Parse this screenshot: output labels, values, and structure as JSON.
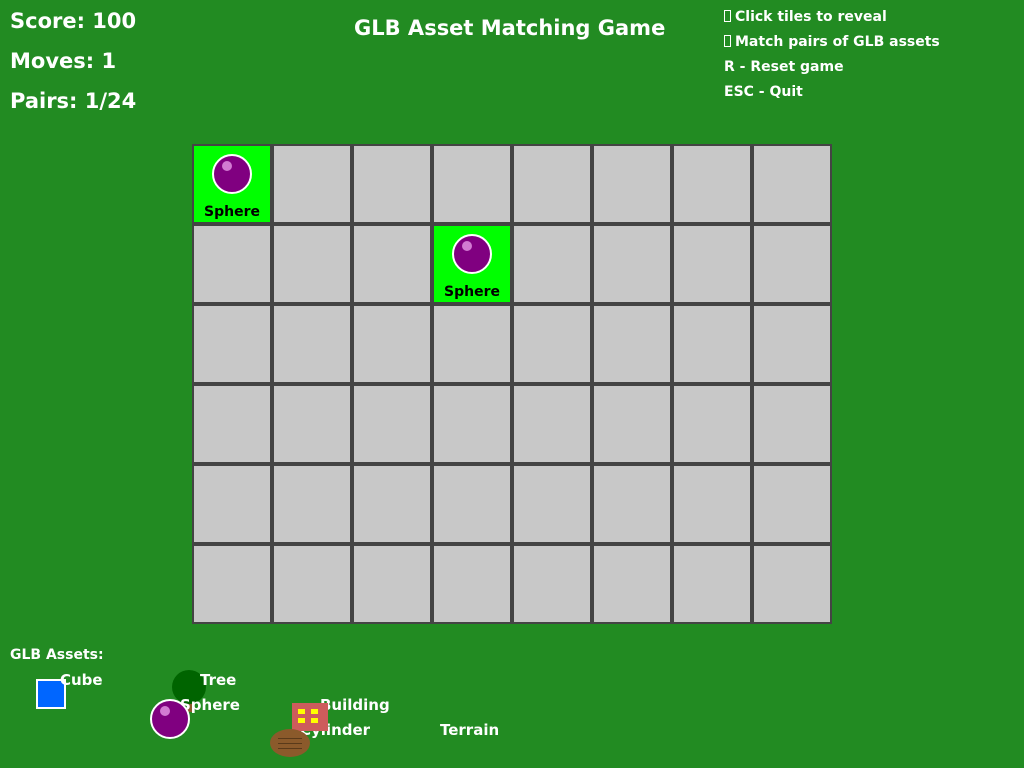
{
  "hud": {
    "score": "Score: 100",
    "moves": "Moves: 1",
    "pairs": "Pairs: 1/24"
  },
  "title": "GLB Asset Matching Game",
  "instructions": [
    {
      "text": "Click tiles to reveal",
      "glyph": "missing-glyph-icon"
    },
    {
      "text": "Match pairs of GLB assets",
      "glyph": "missing-glyph-icon"
    },
    {
      "text": "R - Reset game"
    },
    {
      "text": "ESC - Quit"
    }
  ],
  "board": {
    "rows": 6,
    "cols": 8,
    "revealed": [
      {
        "row": 0,
        "col": 0,
        "label": "Sphere",
        "icon": "sphere-icon"
      },
      {
        "row": 1,
        "col": 3,
        "label": "Sphere",
        "icon": "sphere-icon"
      }
    ]
  },
  "legend": {
    "title": "GLB Assets:",
    "assets": [
      {
        "label": "Cube",
        "icon": "cube-icon"
      },
      {
        "label": "Tree",
        "icon": "tree-icon"
      },
      {
        "label": "Sphere",
        "icon": "sphere-icon"
      },
      {
        "label": "Building",
        "icon": "building-icon"
      },
      {
        "label": "Cylinder",
        "icon": "cylinder-icon"
      },
      {
        "label": "Terrain",
        "icon": "terrain-icon"
      }
    ]
  },
  "colors": {
    "background": "#228b22",
    "tile_hidden": "#c8c8c8",
    "tile_revealed": "#00ff00",
    "sphere": "#800080",
    "cube": "#0066ff",
    "tree": "#006400",
    "building": "#cd5c5c",
    "cylinder": "#8b5a2b"
  }
}
